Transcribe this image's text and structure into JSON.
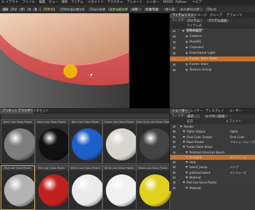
{
  "menubar": {
    "items": [
      "ル",
      "イアウト",
      "ファイル",
      "編集",
      "ビュー",
      "選択",
      "アイテム",
      "ジオメトリ",
      "テクスチャ",
      "アニメート",
      "レンダー",
      "MODO",
      "Python",
      "ヘルプ"
    ]
  },
  "toolbar": {
    "left_items": [
      "選択",
      "アイテム",
      "ポリゴン",
      "エッジ",
      "頂点",
      "ア",
      "マテリアル"
    ],
    "action_center": "アクションセンター",
    "falloff": "フォールオフ",
    "snapping": "スナッピング",
    "symmetry": "対称",
    "workplane": "作業平面",
    "mode1": "ポーズ",
    "mode2": "レンダリング",
    "mode3": "プレイ"
  },
  "items_panel": {
    "tabs": [
      "アイテムリスト",
      "イメージ",
      "グループ",
      "デフォーマ"
    ],
    "filter_label": "フィルター",
    "filter_value": "アイテム",
    "add_item": "アイテム追加",
    "header_name": "アイテム名",
    "items": [
      {
        "label": "名称未設定*",
        "depth": 1,
        "style": "bold"
      },
      {
        "label": "Camera",
        "depth": 2,
        "style": "normal"
      },
      {
        "label": "Bowl01",
        "depth": 2,
        "style": "normal"
      },
      {
        "label": "Capsule1",
        "depth": 2,
        "style": "normal"
      },
      {
        "label": "Directional Light",
        "depth": 2,
        "style": "normal"
      },
      {
        "label": "Fusion Stein Rods",
        "depth": 2,
        "style": "selected"
      },
      {
        "label": "Fusion Stein",
        "depth": 2,
        "style": "normal"
      },
      {
        "label": "Texture Group",
        "depth": 2,
        "style": "normal"
      }
    ]
  },
  "shader_panel": {
    "tabs": [
      "シェーダー",
      "レイヤー",
      "ディスプレイ",
      "ユーザー"
    ],
    "filter_label": "フィルター",
    "filter_value": "表示",
    "add_layer": "レイヤー追加",
    "col_name": "名前",
    "col_effect": "エフェクト",
    "items": [
      {
        "label": "Render",
        "effect": "",
        "depth": 1,
        "style": "normal"
      },
      {
        "label": "Alpha Output",
        "effect": "Alpha",
        "depth": 2,
        "style": "normal"
      },
      {
        "label": "Final Color Output",
        "effect": "Final Color",
        "depth": 2,
        "style": "normal"
      },
      {
        "label": "Base Shader",
        "effect": "フルシェーディング",
        "depth": 2,
        "style": "normal"
      },
      {
        "label": "Fusion Stein Strips",
        "effect": "",
        "depth": 2,
        "style": "normal"
      },
      {
        "label": "Polished American Beech",
        "effect": "",
        "depth": 3,
        "style": "normal"
      },
      {
        "label": "Gradient",
        "effect": "ディフューズ",
        "depth": 3,
        "style": "selected"
      },
      {
        "label": "Hole",
        "effect": "",
        "depth": 3,
        "style": "normal"
      },
      {
        "label": "beech_bump",
        "effect": "バンプ",
        "depth": 3,
        "style": "normal"
      },
      {
        "label": "polished beech",
        "effect": "ディフューズ",
        "depth": 3,
        "style": "normal"
      },
      {
        "label": "Material",
        "effect": "",
        "depth": 3,
        "style": "normal"
      },
      {
        "label": "Red Low Gloss Plastic",
        "effect": "",
        "depth": 2,
        "style": "normal"
      },
      {
        "label": "Material",
        "effect": "",
        "depth": 3,
        "style": "normal"
      }
    ]
  },
  "preset_browser": {
    "tabs": [
      "プリセットブラウザ",
      "ラジオセット"
    ],
    "tiles": [
      {
        "label": "Black Low Gloss Plastic",
        "color": "#7e7e7e"
      },
      {
        "label": "Black Low Gloss Plastic",
        "color": "#111111"
      },
      {
        "label": "Blue Low Gloss Plastic",
        "color": "#1e5fc9"
      },
      {
        "label": "Cream Low Gloss Plastic",
        "color": "#d8d5cc"
      },
      {
        "label": "Dark Grey Low Gloss Plastic",
        "color": "#444444"
      },
      {
        "label": "Red Low Gloss Plastic",
        "color": "#b3b3b3"
      },
      {
        "label": "Red Low Gloss Plastic",
        "color": "#c02020"
      },
      {
        "label": "White Low Gloss Plastic",
        "color": "#eaeaea"
      },
      {
        "label": "White Low Gloss Plastic",
        "color": "#f0f0f0"
      },
      {
        "label": "Yellow Low Gloss Plastic",
        "color": "#e0d020"
      }
    ]
  },
  "colors": {
    "bowl_red": "#d85a5c",
    "bowl_wood": "#e8bfa0",
    "cursor_highlight": "#f0c000",
    "selection": "#c8702a"
  }
}
